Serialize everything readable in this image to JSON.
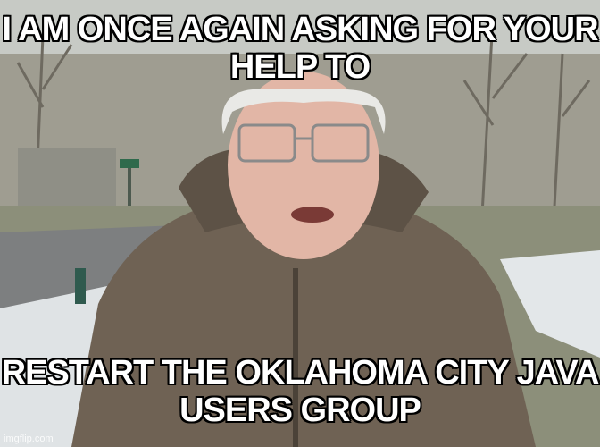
{
  "meme": {
    "top_text": "I AM ONCE AGAIN ASKING FOR YOUR HELP TO",
    "bottom_text": "RESTART THE OKLAHOMA CITY JAVA USERS GROUP",
    "watermark": "imgflip.com"
  },
  "colors": {
    "caption_fill": "#ffffff",
    "caption_outline": "#000000",
    "coat": "#6f6254",
    "sky": "#cfd2ce",
    "snow": "#e4e8ea"
  }
}
